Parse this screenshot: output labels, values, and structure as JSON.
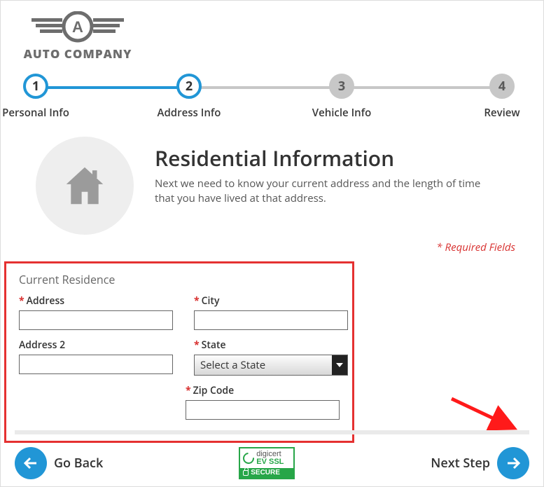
{
  "logo": {
    "text": "AUTO COMPANY"
  },
  "steps": [
    {
      "num": "1",
      "label": "Personal Info"
    },
    {
      "num": "2",
      "label": "Address Info"
    },
    {
      "num": "3",
      "label": "Vehicle Info"
    },
    {
      "num": "4",
      "label": "Review"
    }
  ],
  "heading": {
    "title": "Residential Information",
    "subtitle": "Next we need to know your current address and the length of time that you have lived at that address."
  },
  "required_note": "* Required Fields",
  "form": {
    "section_title": "Current Residence",
    "address_label": "Address",
    "address2_label": "Address 2",
    "city_label": "City",
    "state_label": "State",
    "state_selected": "Select a State",
    "zip_label": "Zip Code"
  },
  "footer": {
    "back_label": "Go Back",
    "next_label": "Next Step",
    "badge_line1a": "digicert",
    "badge_line1b": "EV SSL",
    "badge_line2": "SECURE"
  }
}
